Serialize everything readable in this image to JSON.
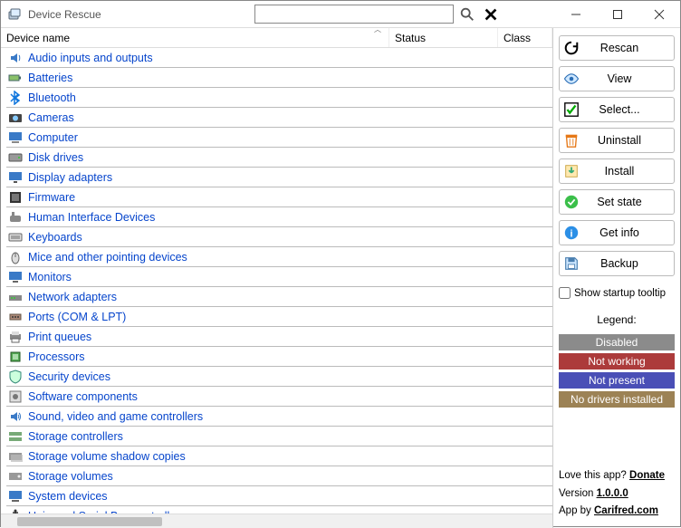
{
  "window": {
    "title": "Device Rescue"
  },
  "search": {
    "value": "",
    "placeholder": ""
  },
  "columns": {
    "name": "Device name",
    "status": "Status",
    "class": "Class"
  },
  "devices": [
    {
      "name": "Audio inputs and outputs",
      "icon": "audio"
    },
    {
      "name": "Batteries",
      "icon": "battery"
    },
    {
      "name": "Bluetooth",
      "icon": "bluetooth"
    },
    {
      "name": "Cameras",
      "icon": "camera"
    },
    {
      "name": "Computer",
      "icon": "computer"
    },
    {
      "name": "Disk drives",
      "icon": "disk"
    },
    {
      "name": "Display adapters",
      "icon": "display"
    },
    {
      "name": "Firmware",
      "icon": "firmware"
    },
    {
      "name": "Human Interface Devices",
      "icon": "hid"
    },
    {
      "name": "Keyboards",
      "icon": "keyboard"
    },
    {
      "name": "Mice and other pointing devices",
      "icon": "mouse"
    },
    {
      "name": "Monitors",
      "icon": "monitor"
    },
    {
      "name": "Network adapters",
      "icon": "network"
    },
    {
      "name": "Ports (COM & LPT)",
      "icon": "port"
    },
    {
      "name": "Print queues",
      "icon": "printer"
    },
    {
      "name": "Processors",
      "icon": "cpu"
    },
    {
      "name": "Security devices",
      "icon": "security"
    },
    {
      "name": "Software components",
      "icon": "software"
    },
    {
      "name": "Sound, video and game controllers",
      "icon": "sound"
    },
    {
      "name": "Storage controllers",
      "icon": "storagectrl"
    },
    {
      "name": "Storage volume shadow copies",
      "icon": "shadow"
    },
    {
      "name": "Storage volumes",
      "icon": "volume"
    },
    {
      "name": "System devices",
      "icon": "system"
    },
    {
      "name": "Universal Serial Bus controllers",
      "icon": "usb"
    }
  ],
  "buttons": {
    "rescan": "Rescan",
    "view": "View",
    "select": "Select...",
    "uninstall": "Uninstall",
    "install": "Install",
    "setstate": "Set state",
    "getinfo": "Get info",
    "backup": "Backup"
  },
  "startup_tooltip_label": "Show startup tooltip",
  "legend": {
    "title": "Legend:",
    "items": [
      {
        "label": "Disabled",
        "bg": "#8b8b8b"
      },
      {
        "label": "Not working",
        "bg": "#ac3b3b"
      },
      {
        "label": "Not present",
        "bg": "#4a4fb6"
      },
      {
        "label": "No drivers installed",
        "bg": "#9c8255"
      }
    ]
  },
  "footer": {
    "love_pre": "Love this app? ",
    "donate": "Donate",
    "version_pre": "Version ",
    "version": "1.0.0.0",
    "appby_pre": "App by ",
    "appby_link": "Carifred.com"
  }
}
